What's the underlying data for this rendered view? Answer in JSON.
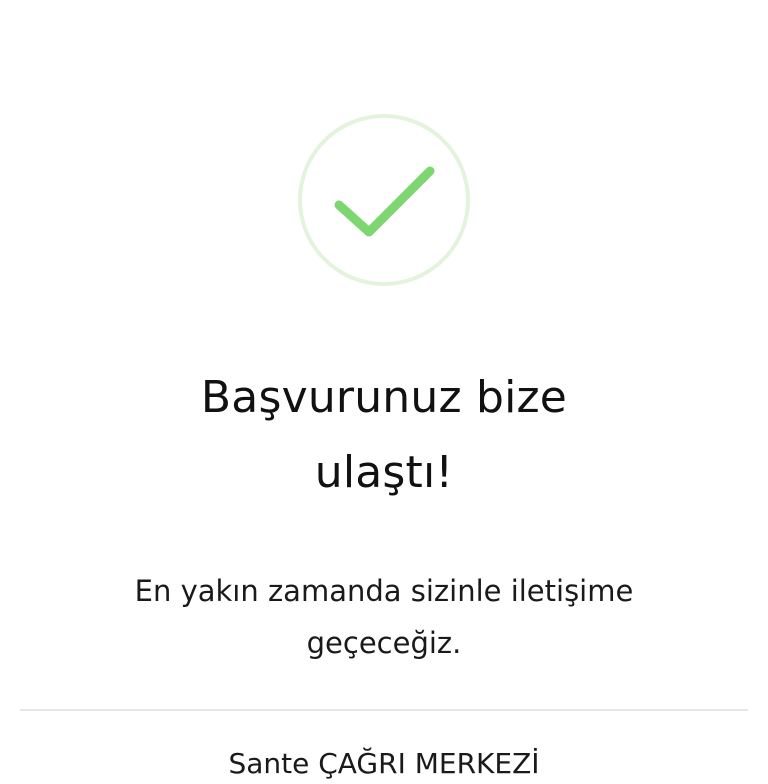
{
  "colors": {
    "check_green": "#7dd66f",
    "ring_green": "#e4f3dc",
    "text": "#111111",
    "divider": "#e6e6e6"
  },
  "icon": {
    "name": "checkmark-circle-icon"
  },
  "title": {
    "line1": "Başvurunuz bize",
    "line2": "ulaştı!"
  },
  "subtitle": {
    "line1": "En yakın zamanda sizinle iletişime",
    "line2": "geçeceğiz."
  },
  "footer": {
    "call_center_label": "Sante ÇAĞRI MERKEZİ"
  }
}
